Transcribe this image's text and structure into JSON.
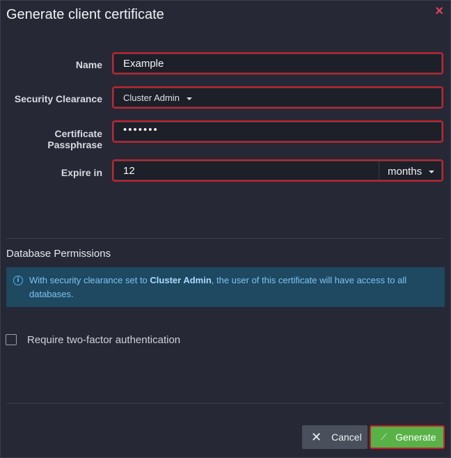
{
  "dialog": {
    "title": "Generate client certificate",
    "close_icon": "×"
  },
  "form": {
    "name_label": "Name",
    "name_value": "Example",
    "clearance_label": "Security Clearance",
    "clearance_value": "Cluster Admin",
    "passphrase_label_line1": "Certificate",
    "passphrase_label_line2": "Passphrase",
    "passphrase_value": "•••••••",
    "expire_label": "Expire in",
    "expire_value": "12",
    "expire_unit": "months"
  },
  "permissions": {
    "section_title": "Database Permissions",
    "info_prefix": "With security clearance set to ",
    "info_bold": "Cluster Admin",
    "info_suffix": ", the user of this certificate will have access to all databases."
  },
  "two_factor": {
    "label": "Require two-factor authentication",
    "checked": false
  },
  "buttons": {
    "cancel_label": "Cancel",
    "generate_label": "Generate"
  },
  "colors": {
    "background": "#262935",
    "highlight": "#cc1f2a",
    "info_bg": "#1f4861",
    "generate_bg": "#58b247",
    "close": "#e0445c"
  }
}
